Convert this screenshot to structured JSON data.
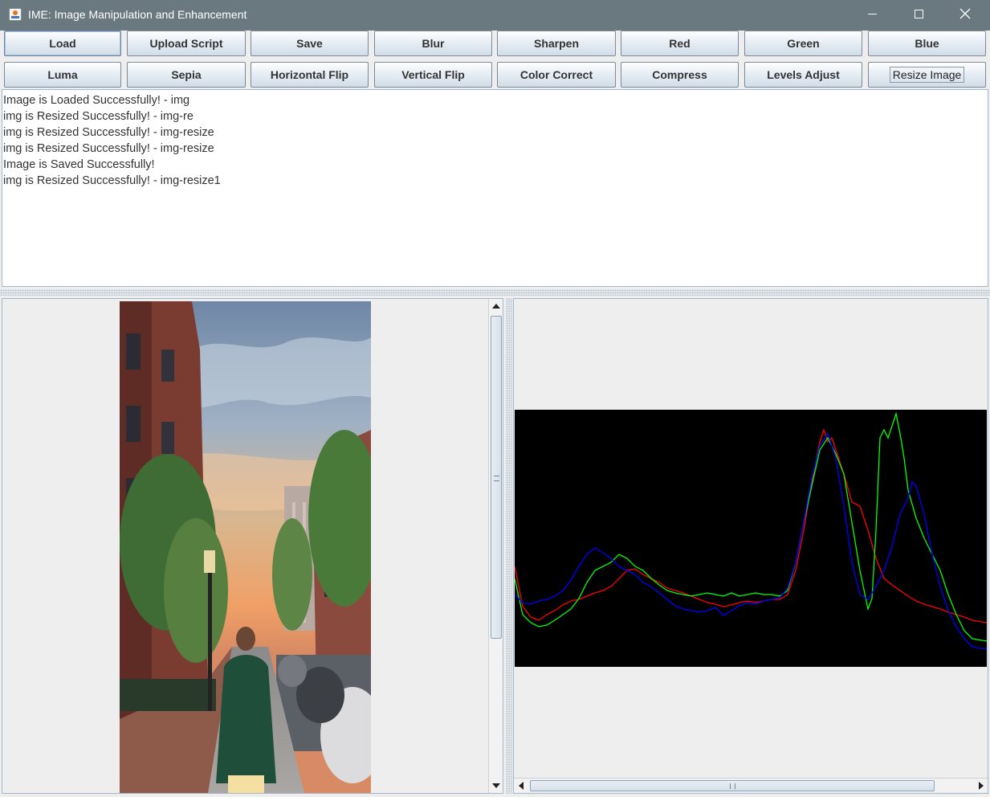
{
  "window": {
    "title": "IME: Image Manipulation and Enhancement",
    "icon": "java-cup-icon",
    "controls": [
      "minimize-icon",
      "maximize-icon",
      "close-icon"
    ]
  },
  "toolbar": {
    "row1": [
      "Load",
      "Upload Script",
      "Save",
      "Blur",
      "Sharpen",
      "Red",
      "Green",
      "Blue"
    ],
    "row2": [
      "Luma",
      "Sepia",
      "Horizontal Flip",
      "Vertical Flip",
      "Color Correct",
      "Compress",
      "Levels Adjust",
      "Resize Image"
    ]
  },
  "log": {
    "lines": [
      "Image is Loaded Successfully! - img",
      "img is Resized Successfully! - img-re",
      "img is Resized Successfully! - img-resize",
      "img is Resized Successfully! - img-resize",
      "Image is Saved Successfully!",
      "img is Resized Successfully! - img-resize1"
    ]
  },
  "image_panel": {
    "scrollbar": "vertical"
  },
  "histogram_panel": {
    "scrollbar": "horizontal",
    "colors": {
      "background": "#000000",
      "red": "#ff0000",
      "green": "#00ff00",
      "blue": "#0000ff"
    }
  }
}
